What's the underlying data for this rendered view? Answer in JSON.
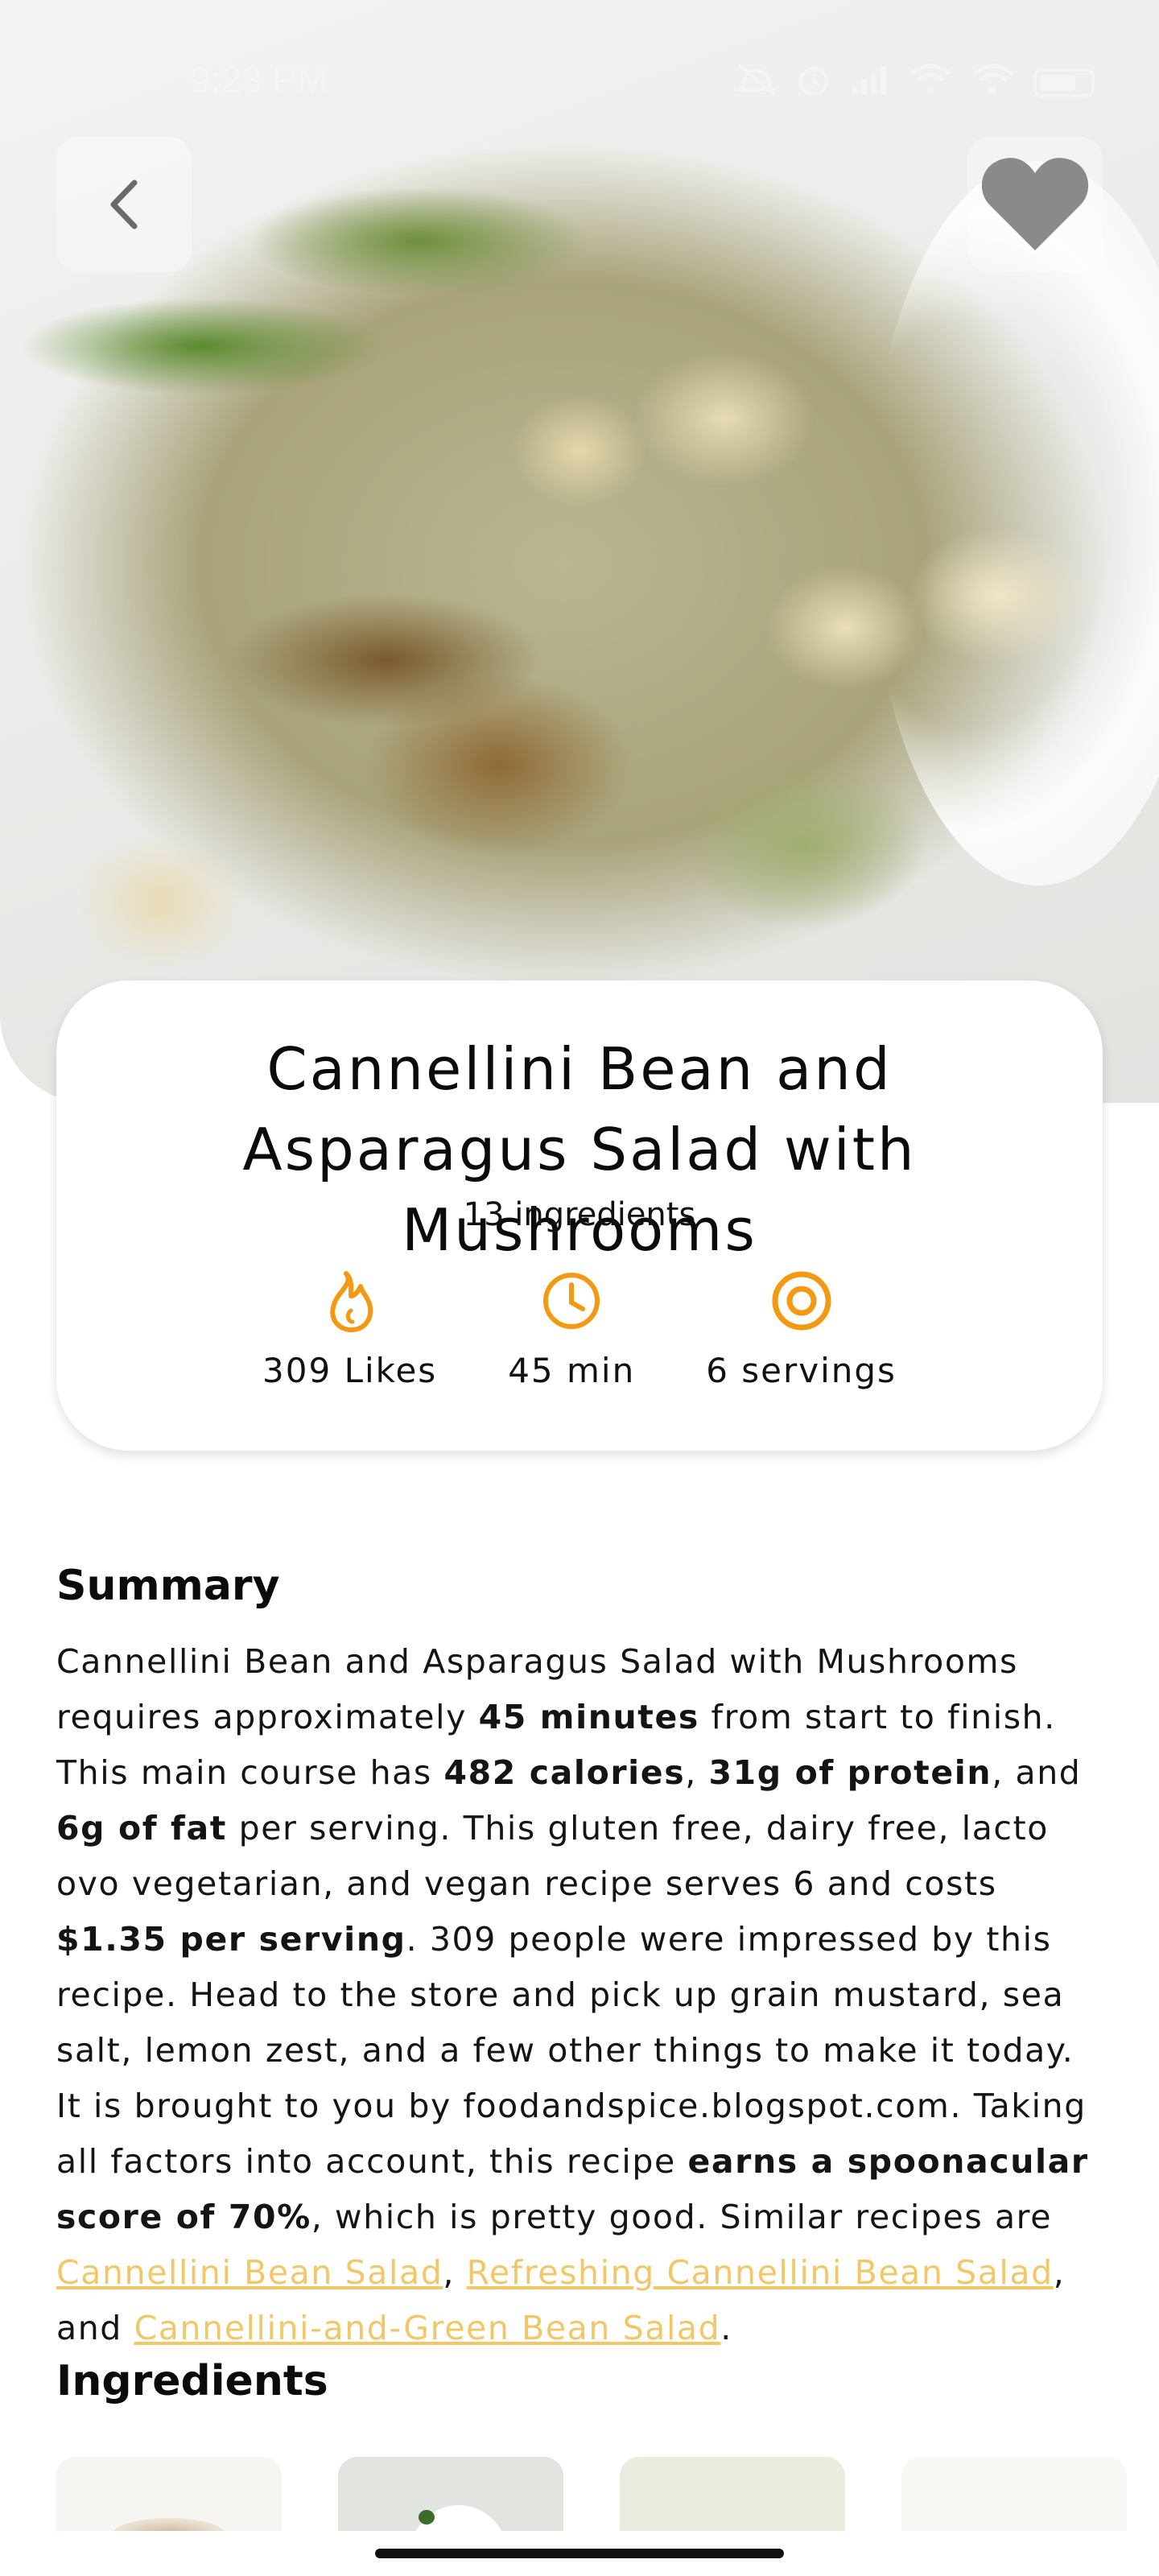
{
  "status_bar": {
    "time": "9:23 PM",
    "battery": "57"
  },
  "nav": {
    "back_icon": "chevron-left-icon",
    "favorite_icon": "heart-icon"
  },
  "recipe": {
    "title": "Cannellini Bean and Asparagus Salad with Mushrooms",
    "ingredients_count": "13 ingredients",
    "stats": [
      {
        "icon": "flame-icon",
        "label": "309 Likes"
      },
      {
        "icon": "clock-icon",
        "label": "45 min"
      },
      {
        "icon": "target-icon",
        "label": "6 servings"
      }
    ],
    "accent_color": "#f29a14"
  },
  "summary": {
    "heading": "Summary",
    "parts": {
      "p1": "Cannellini Bean and Asparagus Salad with Mushrooms requires approximately ",
      "b1": "45 minutes",
      "p2": " from start to finish. This main course has ",
      "b2": "482 calories",
      "p3": ", ",
      "b3": "31g of protein",
      "p4": ", and ",
      "b4": "6g of fat",
      "p5": " per serving. This gluten free, dairy free, lacto ovo vegetarian, and vegan recipe serves 6 and costs ",
      "b5": "$1.35 per serving",
      "p6": ". 309 people were impressed by this recipe. Head to the store and pick up grain mustard, sea salt, lemon zest, and a few other things to make it today. It is brought to you by foodandspice.blogspot.com. Taking all factors into account, this recipe ",
      "b6": "earns a spoonacular score of 70%",
      "p7": ", which is pretty good. Similar recipes are ",
      "link1": "Cannellini Bean Salad",
      "p8": ", ",
      "link2": "Refreshing Cannellini Bean Salad",
      "p9": ", and ",
      "link3": "Cannellini-and-Green Bean Salad",
      "p10": "."
    },
    "link_color": "#f0c86a"
  },
  "ingredients": {
    "heading": "Ingredients"
  }
}
